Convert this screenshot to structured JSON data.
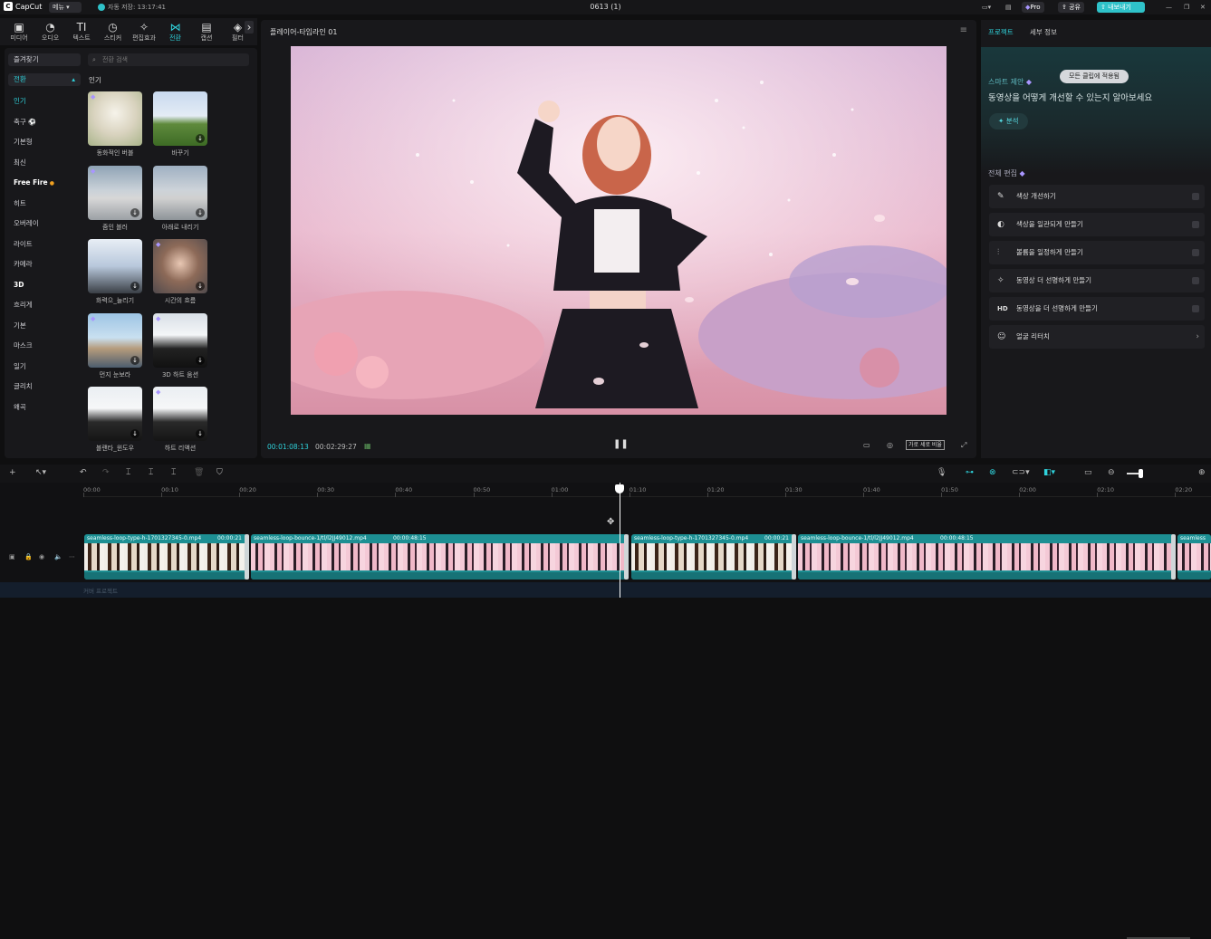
{
  "app": {
    "logo_text": "CapCut",
    "menu_label": "메뉴",
    "autosave": "자동 저장: 13:17:41",
    "project_title": "0613 (1)",
    "pro_label": "Pro",
    "share_label": "공유",
    "export_label": "내보내기",
    "window_controls": [
      "—",
      "❐",
      "✕"
    ]
  },
  "tools": [
    {
      "label": "미디어",
      "icon": "media-icon",
      "glyph": "▣"
    },
    {
      "label": "오디오",
      "icon": "audio-icon",
      "glyph": "◔"
    },
    {
      "label": "텍스트",
      "icon": "text-icon",
      "glyph": "TI"
    },
    {
      "label": "스티커",
      "icon": "sticker-icon",
      "glyph": "◷"
    },
    {
      "label": "편집효과",
      "icon": "effects-icon",
      "glyph": "✧"
    },
    {
      "label": "전환",
      "icon": "transition-icon",
      "glyph": "⋈"
    },
    {
      "label": "캡션",
      "icon": "caption-icon",
      "glyph": "▤"
    },
    {
      "label": "필터",
      "icon": "filter-icon",
      "glyph": "◈"
    }
  ],
  "categories": {
    "favorites": "즐겨찾기",
    "selected": "전환",
    "items": [
      "인기",
      "축구",
      "기본형",
      "최신",
      "Free Fire",
      "히트",
      "오버레이",
      "라이트",
      "카메라",
      "3D",
      "흐리게",
      "기본",
      "마스크",
      "일기",
      "글리치",
      "왜곡"
    ]
  },
  "search_placeholder": "전환 검색",
  "grid_label": "인기",
  "transitions": [
    {
      "label": "동화적인 버블"
    },
    {
      "label": "바꾸기"
    },
    {
      "label": "줌인 블러"
    },
    {
      "label": "아래로 내리기"
    },
    {
      "label": "화력으_늘리기"
    },
    {
      "label": "시간의 흐름"
    },
    {
      "label": "먼지 눈보라"
    },
    {
      "label": "3D 하트 움션"
    },
    {
      "label": "블랜타_윈도우"
    },
    {
      "label": "하트 리액션"
    }
  ],
  "player": {
    "title": "플레이어-타임라인 01",
    "current_time": "00:01:08:13",
    "total_time": "00:02:29:27",
    "aspect_label": "가로 세로 비율"
  },
  "right_panel": {
    "tabs": [
      "프로젝트",
      "세부 정보"
    ],
    "smart_title": "스마트 제안",
    "smart_desc": "동영상을 어떻게 개선할 수 있는지 알아보세요",
    "apply_all": "모든 클립에 적용됨",
    "analyze": "분석",
    "edit_title": "전체 편집",
    "edit_items": [
      {
        "label": "색상 개선하기",
        "icon": "color-enhance-icon"
      },
      {
        "label": "색상을 일관되게 만들기",
        "icon": "color-match-icon"
      },
      {
        "label": "볼륨을 일정하게 만들기",
        "icon": "volume-icon"
      },
      {
        "label": "동영상 더 선명하게 만들기",
        "icon": "sharpen-icon"
      },
      {
        "label": "동영상을 더 선명하게 만들기",
        "icon": "hd-icon"
      },
      {
        "label": "얼굴 리터치",
        "icon": "face-retouch-icon"
      }
    ]
  },
  "timeline": {
    "ruler": [
      "00:00",
      "00:10",
      "00:20",
      "00:30",
      "00:40",
      "00:50",
      "01:00",
      "01:10",
      "01:20",
      "01:30",
      "01:40",
      "01:50",
      "02:00",
      "02:10",
      "02:20"
    ],
    "clips": [
      {
        "name": "seamless-loop-type-h-1701327345-0.mp4",
        "duration": "00:00:21"
      },
      {
        "name": "seamless-loop-bounce-1/tl/l2JJ49012.mp4",
        "duration": "00:00:48:15"
      },
      {
        "name": "seamless-loop-type-h-1701327345-0.mp4",
        "duration": "00:00:21"
      },
      {
        "name": "seamless-loop-bounce-1/tl/l2JJ49012.mp4",
        "duration": "00:00:48:15"
      },
      {
        "name": "seamless",
        "duration": ""
      }
    ],
    "bottom_text": "커버 프로젝트"
  }
}
